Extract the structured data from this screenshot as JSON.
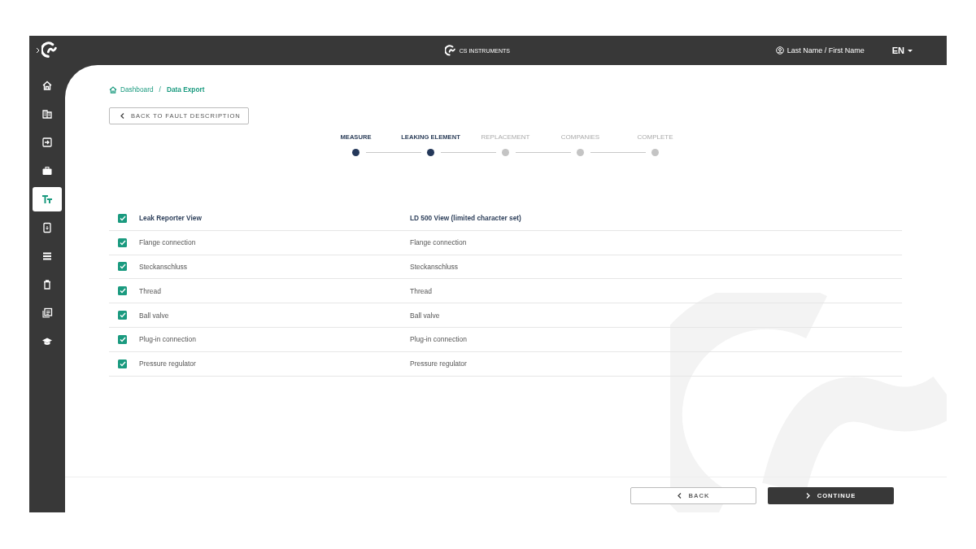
{
  "top_bar": {
    "logo_text": "CS INSTRUMENTS",
    "user": "Last Name / First Name",
    "language": "EN"
  },
  "sidebar": {
    "items": [
      {
        "selected": false
      },
      {
        "selected": false
      },
      {
        "selected": false
      },
      {
        "selected": false
      },
      {
        "selected": true
      },
      {
        "selected": false
      },
      {
        "selected": false
      },
      {
        "selected": false
      },
      {
        "selected": false
      },
      {
        "selected": false
      }
    ]
  },
  "breadcrumb": {
    "separator": "/",
    "items": [
      {
        "label": "Dashboard",
        "current": false
      },
      {
        "label": "Data Export",
        "current": true
      }
    ]
  },
  "back_link": "BACK TO FAULT DESCRIPTION",
  "steps": [
    {
      "label": "MEASURE",
      "completed": true
    },
    {
      "label": "LEAKING ELEMENT",
      "completed": true
    },
    {
      "label": "REPLACEMENT",
      "completed": false
    },
    {
      "label": "COMPANIES",
      "completed": false
    },
    {
      "label": "COMPLETE",
      "completed": false
    }
  ],
  "table": {
    "header": {
      "checked": true,
      "columns": [
        "Leak Reporter View",
        "LD 500 View (limited character set)"
      ]
    },
    "rows": [
      {
        "checked": true,
        "cells": [
          "Flange connection",
          "Flange connection"
        ]
      },
      {
        "checked": true,
        "cells": [
          "Steckanschluss",
          "Steckanschluss"
        ]
      },
      {
        "checked": true,
        "cells": [
          "Thread",
          "Thread"
        ]
      },
      {
        "checked": true,
        "cells": [
          "Ball valve",
          "Ball valve"
        ]
      },
      {
        "checked": true,
        "cells": [
          "Plug-in connection",
          "Plug-in connection"
        ]
      },
      {
        "checked": true,
        "cells": [
          "Pressure regulator",
          "Pressure regulator"
        ]
      }
    ]
  },
  "footer": {
    "back": "BACK",
    "continue": "CONTINUE"
  }
}
